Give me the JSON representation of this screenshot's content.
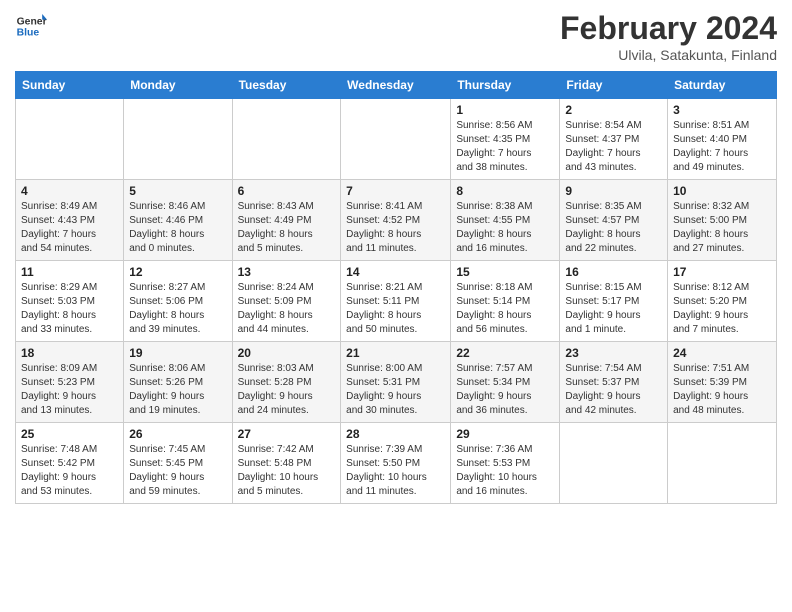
{
  "header": {
    "logo_general": "General",
    "logo_blue": "Blue",
    "month_year": "February 2024",
    "location": "Ulvila, Satakunta, Finland"
  },
  "weekdays": [
    "Sunday",
    "Monday",
    "Tuesday",
    "Wednesday",
    "Thursday",
    "Friday",
    "Saturday"
  ],
  "weeks": [
    [
      {
        "day": "",
        "info": ""
      },
      {
        "day": "",
        "info": ""
      },
      {
        "day": "",
        "info": ""
      },
      {
        "day": "",
        "info": ""
      },
      {
        "day": "1",
        "info": "Sunrise: 8:56 AM\nSunset: 4:35 PM\nDaylight: 7 hours\nand 38 minutes."
      },
      {
        "day": "2",
        "info": "Sunrise: 8:54 AM\nSunset: 4:37 PM\nDaylight: 7 hours\nand 43 minutes."
      },
      {
        "day": "3",
        "info": "Sunrise: 8:51 AM\nSunset: 4:40 PM\nDaylight: 7 hours\nand 49 minutes."
      }
    ],
    [
      {
        "day": "4",
        "info": "Sunrise: 8:49 AM\nSunset: 4:43 PM\nDaylight: 7 hours\nand 54 minutes."
      },
      {
        "day": "5",
        "info": "Sunrise: 8:46 AM\nSunset: 4:46 PM\nDaylight: 8 hours\nand 0 minutes."
      },
      {
        "day": "6",
        "info": "Sunrise: 8:43 AM\nSunset: 4:49 PM\nDaylight: 8 hours\nand 5 minutes."
      },
      {
        "day": "7",
        "info": "Sunrise: 8:41 AM\nSunset: 4:52 PM\nDaylight: 8 hours\nand 11 minutes."
      },
      {
        "day": "8",
        "info": "Sunrise: 8:38 AM\nSunset: 4:55 PM\nDaylight: 8 hours\nand 16 minutes."
      },
      {
        "day": "9",
        "info": "Sunrise: 8:35 AM\nSunset: 4:57 PM\nDaylight: 8 hours\nand 22 minutes."
      },
      {
        "day": "10",
        "info": "Sunrise: 8:32 AM\nSunset: 5:00 PM\nDaylight: 8 hours\nand 27 minutes."
      }
    ],
    [
      {
        "day": "11",
        "info": "Sunrise: 8:29 AM\nSunset: 5:03 PM\nDaylight: 8 hours\nand 33 minutes."
      },
      {
        "day": "12",
        "info": "Sunrise: 8:27 AM\nSunset: 5:06 PM\nDaylight: 8 hours\nand 39 minutes."
      },
      {
        "day": "13",
        "info": "Sunrise: 8:24 AM\nSunset: 5:09 PM\nDaylight: 8 hours\nand 44 minutes."
      },
      {
        "day": "14",
        "info": "Sunrise: 8:21 AM\nSunset: 5:11 PM\nDaylight: 8 hours\nand 50 minutes."
      },
      {
        "day": "15",
        "info": "Sunrise: 8:18 AM\nSunset: 5:14 PM\nDaylight: 8 hours\nand 56 minutes."
      },
      {
        "day": "16",
        "info": "Sunrise: 8:15 AM\nSunset: 5:17 PM\nDaylight: 9 hours\nand 1 minute."
      },
      {
        "day": "17",
        "info": "Sunrise: 8:12 AM\nSunset: 5:20 PM\nDaylight: 9 hours\nand 7 minutes."
      }
    ],
    [
      {
        "day": "18",
        "info": "Sunrise: 8:09 AM\nSunset: 5:23 PM\nDaylight: 9 hours\nand 13 minutes."
      },
      {
        "day": "19",
        "info": "Sunrise: 8:06 AM\nSunset: 5:26 PM\nDaylight: 9 hours\nand 19 minutes."
      },
      {
        "day": "20",
        "info": "Sunrise: 8:03 AM\nSunset: 5:28 PM\nDaylight: 9 hours\nand 24 minutes."
      },
      {
        "day": "21",
        "info": "Sunrise: 8:00 AM\nSunset: 5:31 PM\nDaylight: 9 hours\nand 30 minutes."
      },
      {
        "day": "22",
        "info": "Sunrise: 7:57 AM\nSunset: 5:34 PM\nDaylight: 9 hours\nand 36 minutes."
      },
      {
        "day": "23",
        "info": "Sunrise: 7:54 AM\nSunset: 5:37 PM\nDaylight: 9 hours\nand 42 minutes."
      },
      {
        "day": "24",
        "info": "Sunrise: 7:51 AM\nSunset: 5:39 PM\nDaylight: 9 hours\nand 48 minutes."
      }
    ],
    [
      {
        "day": "25",
        "info": "Sunrise: 7:48 AM\nSunset: 5:42 PM\nDaylight: 9 hours\nand 53 minutes."
      },
      {
        "day": "26",
        "info": "Sunrise: 7:45 AM\nSunset: 5:45 PM\nDaylight: 9 hours\nand 59 minutes."
      },
      {
        "day": "27",
        "info": "Sunrise: 7:42 AM\nSunset: 5:48 PM\nDaylight: 10 hours\nand 5 minutes."
      },
      {
        "day": "28",
        "info": "Sunrise: 7:39 AM\nSunset: 5:50 PM\nDaylight: 10 hours\nand 11 minutes."
      },
      {
        "day": "29",
        "info": "Sunrise: 7:36 AM\nSunset: 5:53 PM\nDaylight: 10 hours\nand 16 minutes."
      },
      {
        "day": "",
        "info": ""
      },
      {
        "day": "",
        "info": ""
      }
    ]
  ]
}
